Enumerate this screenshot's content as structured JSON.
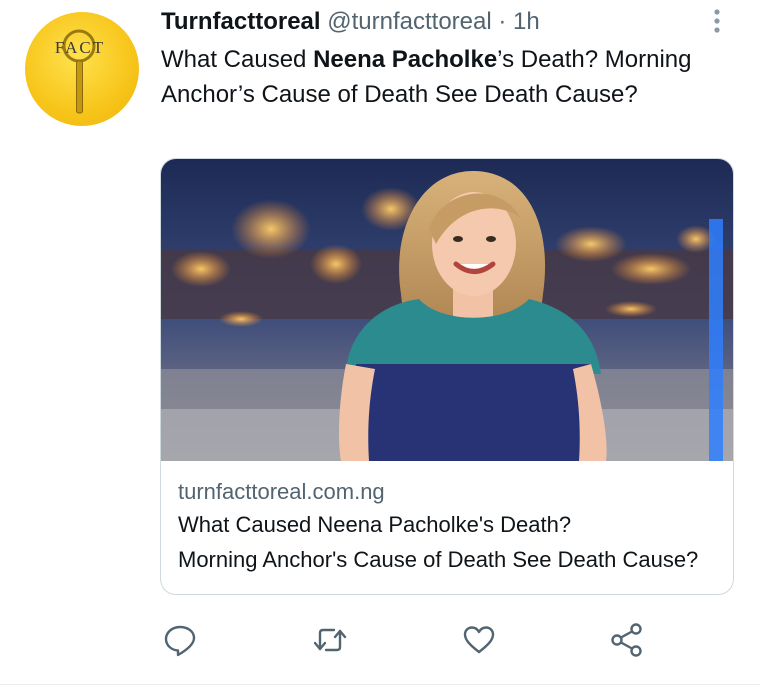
{
  "tweet": {
    "avatar_label": "FACT",
    "author_name": "Turnfacttoreal",
    "handle": "@turnfacttoreal",
    "separator": "·",
    "time": "1h",
    "text_part1": "What Caused ",
    "text_bold": "Neena Pacholke",
    "text_part2": "’s Death? Morning Anchor’s Cause of Death See Death Cause?"
  },
  "card": {
    "domain": "turnfacttoreal.com.ng",
    "title_line1": "What Caused Neena Pacholke's Death?",
    "title_line2": "Morning Anchor's Cause of Death See Death Cause?"
  },
  "icons": {
    "more": "more-vertical-icon",
    "reply": "reply-icon",
    "retweet": "retweet-icon",
    "like": "heart-icon",
    "share": "share-icon"
  },
  "colors": {
    "text": "#0f1419",
    "secondary": "#536471",
    "border": "#cfd9de",
    "avatar": "#f7c51a"
  }
}
